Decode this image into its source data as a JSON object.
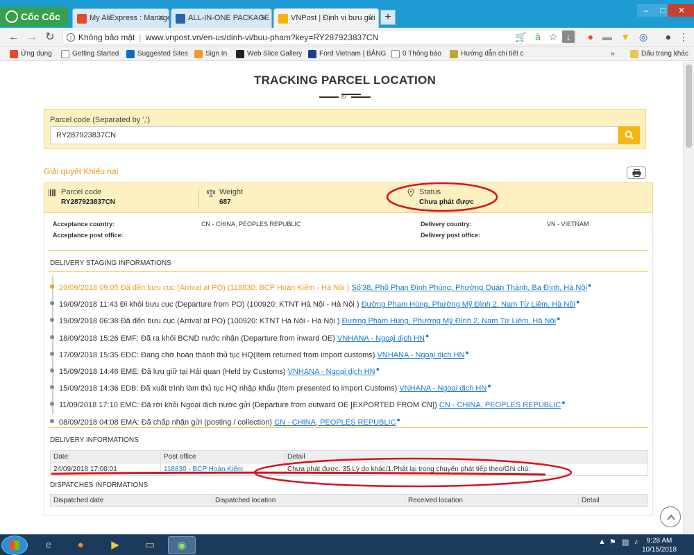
{
  "browser": {
    "brand": "Cốc Cốc",
    "tabs": [
      {
        "title": "My AliExpress : Manage C",
        "active": false,
        "color": "#e44b2b"
      },
      {
        "title": "ALL-IN-ONE PACKAGE T",
        "active": false,
        "color": "#2563b3"
      },
      {
        "title": "VNPost | Định vị bưu gửi",
        "active": true,
        "color": "#f5b400"
      }
    ],
    "new_tab": "+",
    "security_label": "Không bảo mật",
    "url": "www.vnpost.vn/en-us/dinh-vi/buu-pham?key=RY287923837CN",
    "bookmarks": [
      {
        "label": "Ứng dụng",
        "color": "#e44b2b"
      },
      {
        "label": "Getting Started",
        "color": "#888888"
      },
      {
        "label": "Suggested Sites",
        "color": "#0f6cbd"
      },
      {
        "label": "Sign In",
        "color": "#f29a22"
      },
      {
        "label": "Web Slice Gallery",
        "color": "#222222"
      },
      {
        "label": "Ford Vietnam | BẢNG",
        "color": "#1b3f8f"
      },
      {
        "label": "0 Thông báo",
        "color": "#888888"
      },
      {
        "label": "Hướng dẫn chi tiết c",
        "color": "#c7a32e"
      }
    ],
    "bookmarks_more": "»",
    "bookmarks_folder": "Dấu trang khác"
  },
  "page": {
    "title": "TRACKING PARCEL LOCATION",
    "search": {
      "label": "Parcel code (Separated by ',')",
      "value": "RY287923837CN"
    },
    "complaint_link": "Giải quyết Khiếu nại",
    "summary": {
      "parcel_code_label": "Parcel code",
      "parcel_code": "RY287923837CN",
      "weight_label": "Weight",
      "weight": "687",
      "status_label": "Status",
      "status": "Chưa phát được"
    },
    "origin": {
      "acceptance_country_label": "Acceptance country:",
      "acceptance_country": "CN - CHINA, PEOPLES REPUBLIC",
      "acceptance_office_label": "Acceptance post office:",
      "delivery_country_label": "Delivery country:",
      "delivery_country": "VN - VIETNAM",
      "delivery_office_label": "Delivery post office:"
    },
    "staging_title": "DELIVERY STAGING INFORMATIONS",
    "events": [
      {
        "time": "20/09/2018 09:05",
        "desc": "Đã đến bưu cục (Arrival at PO) (118830: BCP Hoàn Kiếm - Hà Nội )",
        "location": "Số'38, Phố Phan Đình Phùng, Phường Quán Thánh, Ba Đình, Hà Nội",
        "current": true
      },
      {
        "time": "19/09/2018 11:43",
        "desc": "Đi khỏi bưu cục (Departure from PO) (100920: KTNT Hà Nội - Hà Nội )",
        "location": "Đường Phạm Hùng, Phường Mỹ Đình 2, Nam Từ Liêm, Hà Nội",
        "current": false
      },
      {
        "time": "19/09/2018 06:38",
        "desc": "Đã đến bưu cục (Arrival at PO) (100920: KTNT Hà Nội - Hà Nội )",
        "location": "Đường Phạm Hùng, Phường Mỹ Đình 2, Nam Từ Liêm, Hà Nội",
        "current": false
      },
      {
        "time": "18/09/2018 15:26",
        "desc": "EMF: Đã ra khỏi BCND nước nhận (Departure from inward OE)",
        "location": "VNHANA - Ngoại dịch HN",
        "current": false
      },
      {
        "time": "17/09/2018 15:35",
        "desc": "EDC: Đang chờ hoàn thành thủ tục HQ(Item returned from import customs)",
        "location": "VNHANA - Ngoại dịch HN",
        "current": false
      },
      {
        "time": "15/09/2018 14:46",
        "desc": "EME: Đã lưu giữ tại Hải quan (Held by Customs)",
        "location": "VNHANA - Ngoại dịch HN",
        "current": false
      },
      {
        "time": "15/09/2018 14:36",
        "desc": "EDB: Đã xuất trình làm thủ tục HQ nhập khẩu (Item presented to import Customs)",
        "location": "VNHANA - Ngoại dịch HN",
        "current": false
      },
      {
        "time": "11/09/2018 17:10",
        "desc": "EMC: Đã rời khỏi Ngoại dịch nước gửi (Departure from outward OE [EXPORTED FROM CN])",
        "location": "CN - CHINA, PEOPLES REPUBLIC",
        "current": false
      },
      {
        "time": "08/09/2018 04:08",
        "desc": "EMA: Đã chấp nhận gửi (posting / collection)",
        "location": "CN - CHINA, PEOPLES REPUBLIC",
        "current": false
      }
    ],
    "delivery_title": "DELIVERY INFORMATIONS",
    "delivery_headers": [
      "Date:",
      "Post office",
      "Detail"
    ],
    "delivery_rows": [
      {
        "date": "24/09/2018 17:00:01",
        "office": "118830 - BCP Hoàn Kiếm",
        "detail": "Chưa phát được. 35.Lý do khác/1.Phát lại trong chuyến phát tiếp theo/Ghi chú:"
      }
    ],
    "dispatch_title": "DISPATCHES INFORMATIONS",
    "dispatch_headers": [
      "Dispatched date",
      "Dispatched location",
      "Received location",
      "Detail"
    ]
  },
  "taskbar": {
    "time": "9:28 AM",
    "date": "10/15/2018"
  },
  "colors": {
    "accent_orange": "#f29a22",
    "panel_yellow": "#fdf1c2",
    "link_blue": "#1a79c7",
    "annotation_red": "#d8131b"
  }
}
